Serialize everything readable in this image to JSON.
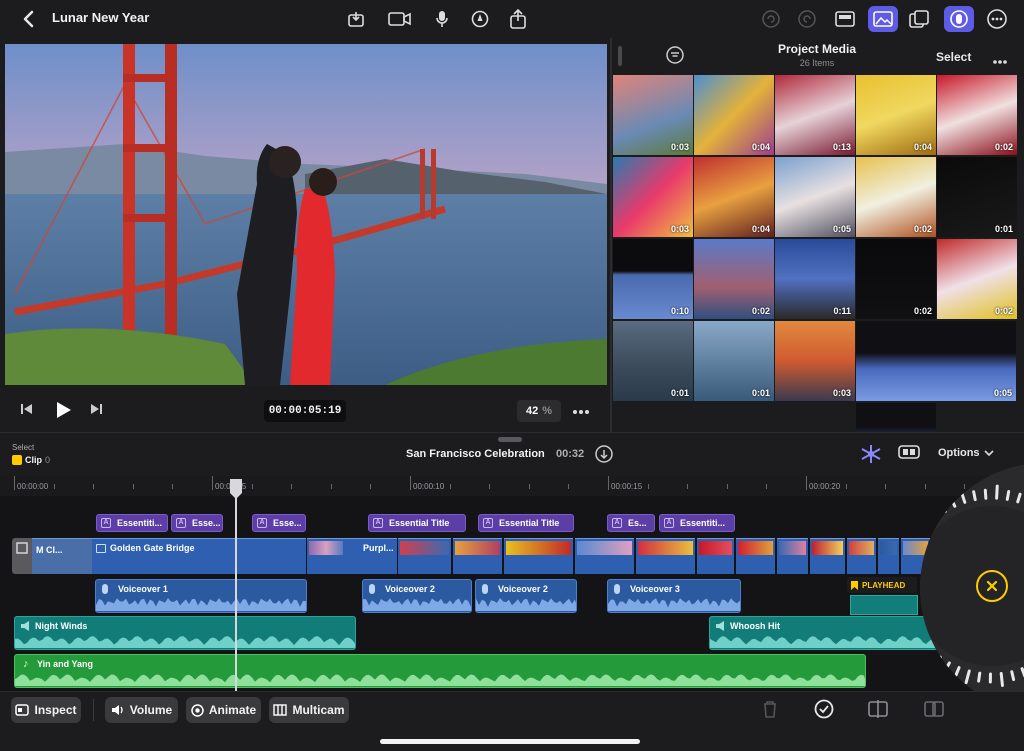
{
  "header": {
    "back_icon": "chevron-left-icon",
    "project_title": "Lunar New Year"
  },
  "viewer": {
    "timecode": "00:00:05:19",
    "zoom_value": "42",
    "zoom_unit": "%"
  },
  "browser": {
    "title": "Project Media",
    "subtitle": "26 Items",
    "select_label": "Select"
  },
  "media": [
    {
      "dur": "0:03"
    },
    {
      "dur": "0:04"
    },
    {
      "dur": "0:13"
    },
    {
      "dur": "0:04"
    },
    {
      "dur": "0:02"
    },
    {
      "dur": "0:03"
    },
    {
      "dur": "0:04"
    },
    {
      "dur": "0:05"
    },
    {
      "dur": "0:02"
    },
    {
      "dur": "0:01"
    },
    {
      "dur": "0:10"
    },
    {
      "dur": "0:02"
    },
    {
      "dur": "0:11"
    },
    {
      "dur": "0:02"
    },
    {
      "dur": "0:02"
    },
    {
      "dur": "0:01"
    },
    {
      "dur": "0:01"
    },
    {
      "dur": "0:03"
    },
    {
      "dur": "0:05"
    },
    {
      "dur": ""
    }
  ],
  "timeline": {
    "select_label": "Select",
    "clip_label": "Clip",
    "clip_count": "0",
    "project_name": "San Francisco Celebration",
    "duration": "00:32",
    "options_label": "Options",
    "ruler": [
      "00:00:00",
      "00:00:05",
      "00:00:10",
      "00:00:15",
      "00:00:20"
    ],
    "titles": [
      "Essentiti...",
      "Esse...",
      "Esse...",
      "Essential Title",
      "Essential Title",
      "Es...",
      "Essentiti..."
    ],
    "main_clip_label": "M Cl...",
    "primary_clip": "Golden Gate Bridge",
    "purple_clip": "Purpl...",
    "voiceovers": [
      "Voiceover 1",
      "Voiceover 2",
      "Voiceover 2",
      "Voiceover 3"
    ],
    "playhead_badge": "PLAYHEAD",
    "audio1": "Night Winds",
    "audio2": "Whoosh Hit",
    "music": "Yin and Yang"
  },
  "bottom": {
    "inspect": "Inspect",
    "volume": "Volume",
    "animate": "Animate",
    "multicam": "Multicam"
  },
  "colors": {
    "accent": "#5e5ce6",
    "title_pill": "#5b3fa6",
    "video_clip": "#2e5fb0",
    "audio_teal": "#138a86",
    "music_green": "#2aa33f",
    "jog_yellow": "#ffcc00"
  }
}
